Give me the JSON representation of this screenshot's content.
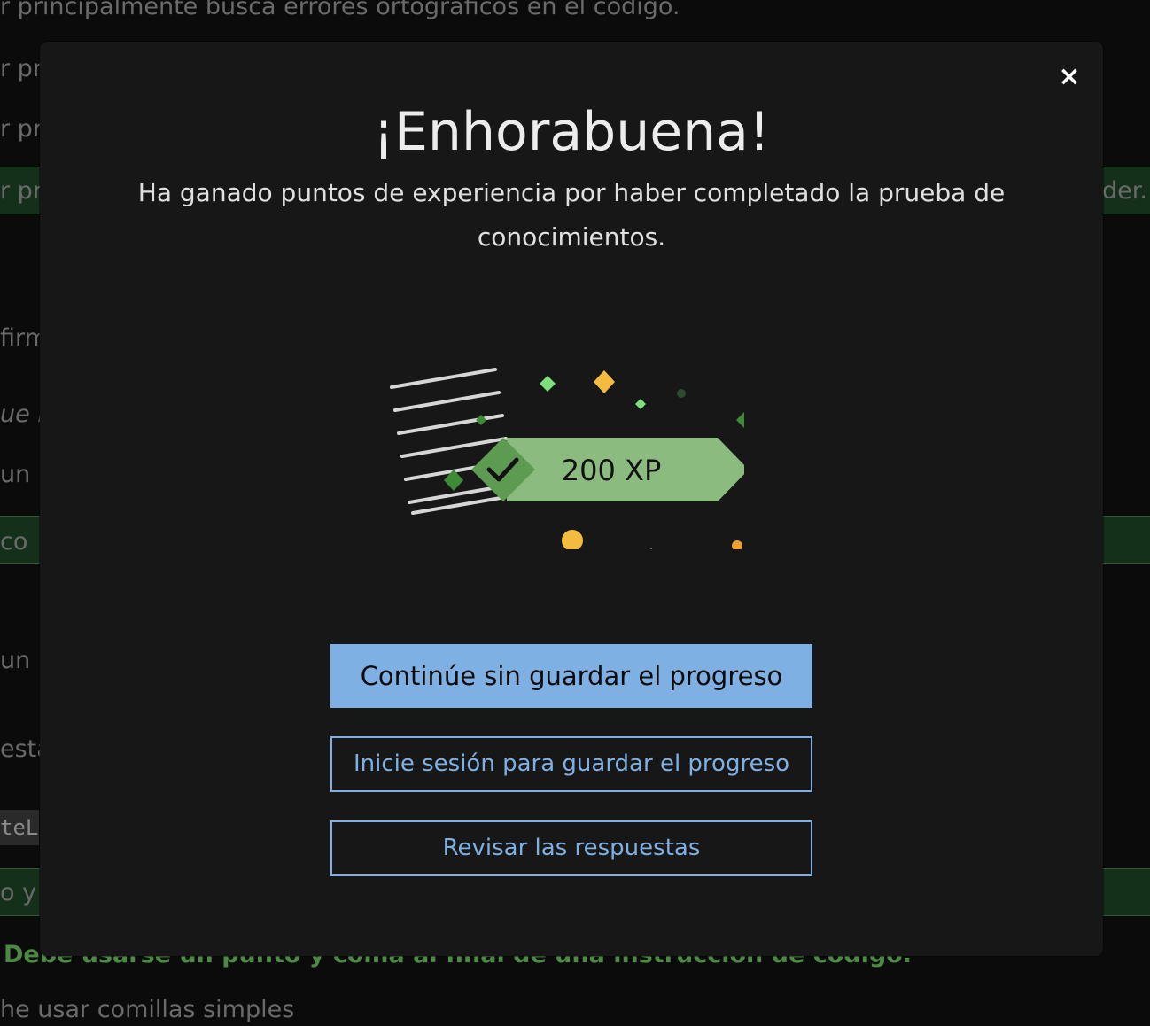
{
  "background": {
    "lines": [
      "r principalmente busca errores ortográficos en el código.",
      "r pr",
      "r pr",
      "r pr",
      "firm",
      "ue r",
      "un r",
      " co",
      "un",
      "esta",
      "o y",
      "he usar comillas simples"
    ],
    "right_fragment": "der.",
    "code_fragment": "teL",
    "bottom_text": "Debe usarse un punto y coma al final de una instrucción de código."
  },
  "modal": {
    "close_label": "×",
    "title": "¡Enhorabuena!",
    "subtitle": "Ha ganado puntos de experiencia por haber completado la prueba de conocimientos.",
    "xp_label": "200 XP",
    "buttons": {
      "continue": "Continúe sin guardar el progreso",
      "signin": "Inicie sesión para guardar el progreso",
      "review": "Revisar las respuestas"
    }
  },
  "colors": {
    "accent": "#7fb0e3",
    "xp_banner": "#8cbb80",
    "check_green": "#5d9b52",
    "confetti_yellow": "#f3bc3e",
    "confetti_green": "#7ee07a"
  }
}
